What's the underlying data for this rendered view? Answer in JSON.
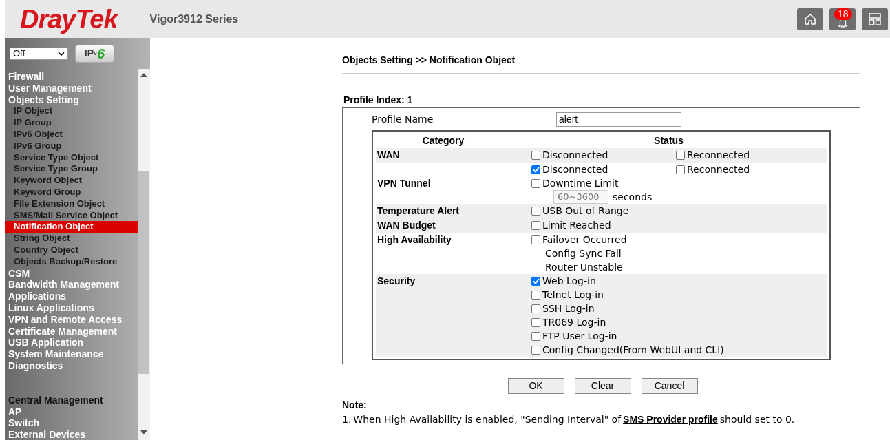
{
  "header": {
    "logo": "DrayTek",
    "model": "Vigor3912 Series",
    "notification_count": "18"
  },
  "sidebar": {
    "mode_select": "Off",
    "ipv6_logo": {
      "main": "IP",
      "sub": "v",
      "num": "6"
    },
    "items": [
      {
        "label": "Firewall",
        "kind": "top",
        "selected": false
      },
      {
        "label": "User Management",
        "kind": "top",
        "selected": false
      },
      {
        "label": "Objects Setting",
        "kind": "top",
        "selected": false
      },
      {
        "label": "IP Object",
        "kind": "sub",
        "selected": false
      },
      {
        "label": "IP Group",
        "kind": "sub",
        "selected": false
      },
      {
        "label": "IPv6 Object",
        "kind": "sub",
        "selected": false
      },
      {
        "label": "IPv6 Group",
        "kind": "sub",
        "selected": false
      },
      {
        "label": "Service Type Object",
        "kind": "sub",
        "selected": false
      },
      {
        "label": "Service Type Group",
        "kind": "sub",
        "selected": false
      },
      {
        "label": "Keyword Object",
        "kind": "sub",
        "selected": false
      },
      {
        "label": "Keyword Group",
        "kind": "sub",
        "selected": false
      },
      {
        "label": "File Extension Object",
        "kind": "sub",
        "selected": false
      },
      {
        "label": "SMS/Mail Service Object",
        "kind": "sub",
        "selected": false
      },
      {
        "label": "Notification Object",
        "kind": "sub",
        "selected": true
      },
      {
        "label": "String Object",
        "kind": "sub",
        "selected": false
      },
      {
        "label": "Country Object",
        "kind": "sub",
        "selected": false
      },
      {
        "label": "Objects Backup/Restore",
        "kind": "sub",
        "selected": false
      },
      {
        "label": "CSM",
        "kind": "top",
        "selected": false
      },
      {
        "label": "Bandwidth Management",
        "kind": "top",
        "selected": false
      },
      {
        "label": "Applications",
        "kind": "top",
        "selected": false
      },
      {
        "label": "Linux Applications",
        "kind": "top",
        "selected": false
      },
      {
        "label": "VPN and Remote Access",
        "kind": "top",
        "selected": false
      },
      {
        "label": "Certificate Management",
        "kind": "top",
        "selected": false
      },
      {
        "label": "USB Application",
        "kind": "top",
        "selected": false
      },
      {
        "label": "System Maintenance",
        "kind": "top",
        "selected": false
      },
      {
        "label": "Diagnostics",
        "kind": "top",
        "selected": false
      },
      {
        "label": "Central Management",
        "kind": "section",
        "selected": false
      },
      {
        "label": "AP",
        "kind": "top",
        "selected": false
      },
      {
        "label": "Switch",
        "kind": "top",
        "selected": false
      },
      {
        "label": "External Devices",
        "kind": "top",
        "selected": false
      }
    ]
  },
  "page": {
    "breadcrumb": "Objects Setting >> Notification Object",
    "profile_index": "Profile Index: 1",
    "profile_name": {
      "label": "Profile Name",
      "value": "alert"
    },
    "table": {
      "columns": [
        "Category",
        "Status"
      ],
      "rows": [
        {
          "category": "WAN",
          "shaded": true,
          "lines": [
            [
              {
                "kind": "checkbox",
                "label": "Disconnected",
                "checked": false
              },
              {
                "kind": "checkbox",
                "label": "Reconnected",
                "checked": false
              }
            ]
          ]
        },
        {
          "category": "VPN Tunnel",
          "shaded": false,
          "lines": [
            [
              {
                "kind": "checkbox",
                "label": "Disconnected",
                "checked": true
              },
              {
                "kind": "checkbox",
                "label": "Reconnected",
                "checked": false
              }
            ],
            [
              {
                "kind": "checkbox",
                "label": "Downtime Limit",
                "checked": false
              }
            ],
            [
              {
                "kind": "number",
                "placeholder": "60~3600",
                "unit": "seconds"
              }
            ]
          ]
        },
        {
          "category": "Temperature Alert",
          "shaded": true,
          "lines": [
            [
              {
                "kind": "checkbox",
                "label": "USB Out of Range",
                "checked": false
              }
            ]
          ]
        },
        {
          "category": "WAN Budget",
          "shaded": true,
          "lines": [
            [
              {
                "kind": "checkbox",
                "label": "Limit Reached",
                "checked": false
              }
            ]
          ]
        },
        {
          "category": "High Availability",
          "shaded": false,
          "lines": [
            [
              {
                "kind": "checkbox",
                "label": "Failover Occurred",
                "checked": false
              }
            ],
            [
              {
                "kind": "text",
                "label": "Config Sync Fail"
              }
            ],
            [
              {
                "kind": "text",
                "label": "Router Unstable"
              }
            ]
          ]
        },
        {
          "category": "Security",
          "shaded": true,
          "lines": [
            [
              {
                "kind": "checkbox",
                "label": "Web Log-in",
                "checked": true
              }
            ],
            [
              {
                "kind": "checkbox",
                "label": "Telnet Log-in",
                "checked": false
              }
            ],
            [
              {
                "kind": "checkbox",
                "label": "SSH Log-in",
                "checked": false
              }
            ],
            [
              {
                "kind": "checkbox",
                "label": "TR069 Log-in",
                "checked": false
              }
            ],
            [
              {
                "kind": "checkbox",
                "label": "FTP User Log-in",
                "checked": false
              }
            ],
            [
              {
                "kind": "checkbox",
                "label": "Config Changed(From WebUI and CLI)",
                "checked": false
              }
            ]
          ]
        }
      ]
    },
    "buttons": [
      "OK",
      "Clear",
      "Cancel"
    ],
    "note": {
      "title": "Note:",
      "items": [
        {
          "number": "1.",
          "before": "When High Availability is enabled, \"Sending Interval\" of",
          "link": "SMS Provider profile",
          "after": "should set to 0."
        }
      ]
    }
  }
}
